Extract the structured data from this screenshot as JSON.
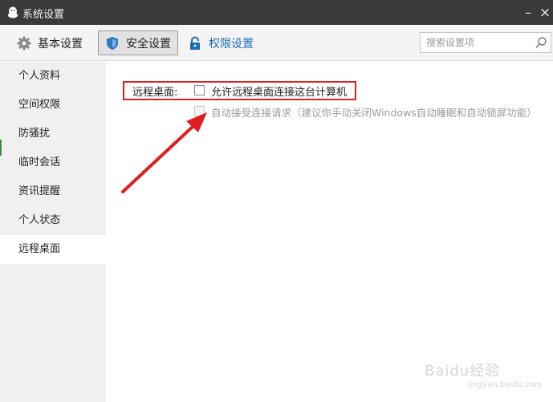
{
  "window": {
    "title": "系统设置",
    "minimize": "–",
    "close": "×"
  },
  "toolbar": {
    "basic_label": "基本设置",
    "security_label": "安全设置",
    "permission_label": "权限设置",
    "search_placeholder": "搜索设置项"
  },
  "sidebar": {
    "items": [
      {
        "label": "个人资料"
      },
      {
        "label": "空间权限"
      },
      {
        "label": "防骚扰"
      },
      {
        "label": "临时会话"
      },
      {
        "label": "资讯提醒"
      },
      {
        "label": "个人状态"
      },
      {
        "label": "远程桌面",
        "active": true
      }
    ]
  },
  "content": {
    "section_label": "远程桌面:",
    "allow_remote_label": "允许远程桌面连接这台计算机",
    "allow_remote_checked": false,
    "auto_accept_label": "自动接受连接请求（建议你手动关闭Windows自动睡眠和自动锁屏功能）",
    "auto_accept_checked": false,
    "auto_accept_disabled": true
  },
  "watermark": {
    "text": "Baidu经验",
    "sub": "jingyan.baidu.com"
  },
  "colors": {
    "titlebar": "#3a3a3a",
    "link_blue": "#1a6db5",
    "highlight_red": "#e02020"
  }
}
